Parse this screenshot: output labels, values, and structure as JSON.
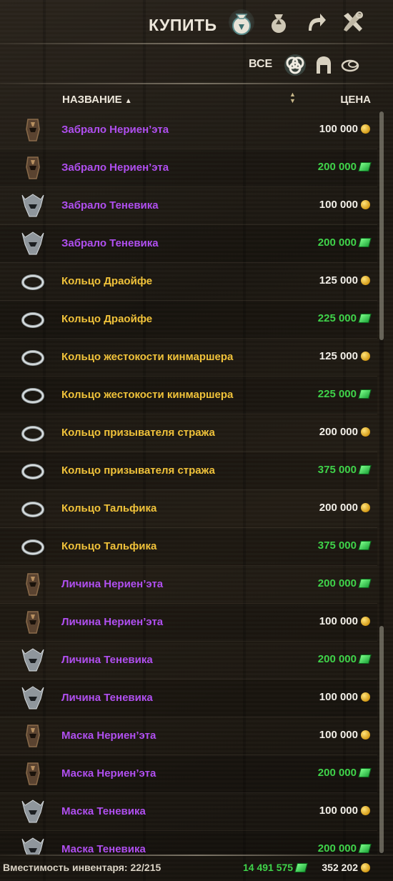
{
  "header": {
    "title": "КУПИТЬ",
    "mode_icons": [
      "buy-bag-icon",
      "sell-bag-icon",
      "buyback-arrow-icon",
      "repair-tools-icon"
    ]
  },
  "filters": {
    "label": "ВСЕ",
    "icons": [
      "all-items-icon",
      "armor-icon",
      "jewelry-icon"
    ]
  },
  "columns": {
    "name": "НАЗВАНИЕ",
    "sort_indicator": "▲",
    "price": "ЦЕНА"
  },
  "items": [
    {
      "name": "Забрало Нериен’эта",
      "quality": "purple",
      "icon": "helm-nerien-icon",
      "price": "100 000",
      "currency": "gold"
    },
    {
      "name": "Забрало Нериен’эта",
      "quality": "purple",
      "icon": "helm-nerien-icon",
      "price": "200 000",
      "currency": "gem"
    },
    {
      "name": "Забрало Теневика",
      "quality": "purple",
      "icon": "helm-shadow-icon",
      "price": "100 000",
      "currency": "gold"
    },
    {
      "name": "Забрало Теневика",
      "quality": "purple",
      "icon": "helm-shadow-icon",
      "price": "200 000",
      "currency": "gem"
    },
    {
      "name": "Кольцо Драойфе",
      "quality": "gold",
      "icon": "ring-icon",
      "price": "125 000",
      "currency": "gold"
    },
    {
      "name": "Кольцо Драойфе",
      "quality": "gold",
      "icon": "ring-icon",
      "price": "225 000",
      "currency": "gem"
    },
    {
      "name": "Кольцо жестокости кинмаршера",
      "quality": "gold",
      "icon": "ring-icon",
      "price": "125 000",
      "currency": "gold"
    },
    {
      "name": "Кольцо жестокости кинмаршера",
      "quality": "gold",
      "icon": "ring-icon",
      "price": "225 000",
      "currency": "gem"
    },
    {
      "name": "Кольцо призывателя стража",
      "quality": "gold",
      "icon": "ring-icon",
      "price": "200 000",
      "currency": "gold"
    },
    {
      "name": "Кольцо призывателя стража",
      "quality": "gold",
      "icon": "ring-icon",
      "price": "375 000",
      "currency": "gem"
    },
    {
      "name": "Кольцо Тальфика",
      "quality": "gold",
      "icon": "ring-icon",
      "price": "200 000",
      "currency": "gold"
    },
    {
      "name": "Кольцо Тальфика",
      "quality": "gold",
      "icon": "ring-icon",
      "price": "375 000",
      "currency": "gem"
    },
    {
      "name": "Личина Нериен’эта",
      "quality": "purple",
      "icon": "helm-nerien-icon",
      "price": "200 000",
      "currency": "gem"
    },
    {
      "name": "Личина Нериен’эта",
      "quality": "purple",
      "icon": "helm-nerien-icon",
      "price": "100 000",
      "currency": "gold"
    },
    {
      "name": "Личина Теневика",
      "quality": "purple",
      "icon": "helm-shadow-icon",
      "price": "200 000",
      "currency": "gem"
    },
    {
      "name": "Личина Теневика",
      "quality": "purple",
      "icon": "helm-shadow-icon",
      "price": "100 000",
      "currency": "gold"
    },
    {
      "name": "Маска Нериен’эта",
      "quality": "purple",
      "icon": "helm-nerien-icon",
      "price": "100 000",
      "currency": "gold"
    },
    {
      "name": "Маска Нериен’эта",
      "quality": "purple",
      "icon": "helm-nerien-icon",
      "price": "200 000",
      "currency": "gem"
    },
    {
      "name": "Маска Теневика",
      "quality": "purple",
      "icon": "helm-shadow-icon",
      "price": "100 000",
      "currency": "gold"
    },
    {
      "name": "Маска Теневика",
      "quality": "purple",
      "icon": "helm-shadow-icon",
      "price": "200 000",
      "currency": "gem"
    }
  ],
  "footer": {
    "capacity_label": "Вместимость инвентаря: 22/215",
    "gem_balance": "14 491 575",
    "gold_balance": "352 202"
  },
  "colors": {
    "purple_quality": "#b04ff0",
    "gold_quality": "#f0c23a",
    "gem_price": "#3fd34a",
    "gold_price": "#f2efe8"
  }
}
